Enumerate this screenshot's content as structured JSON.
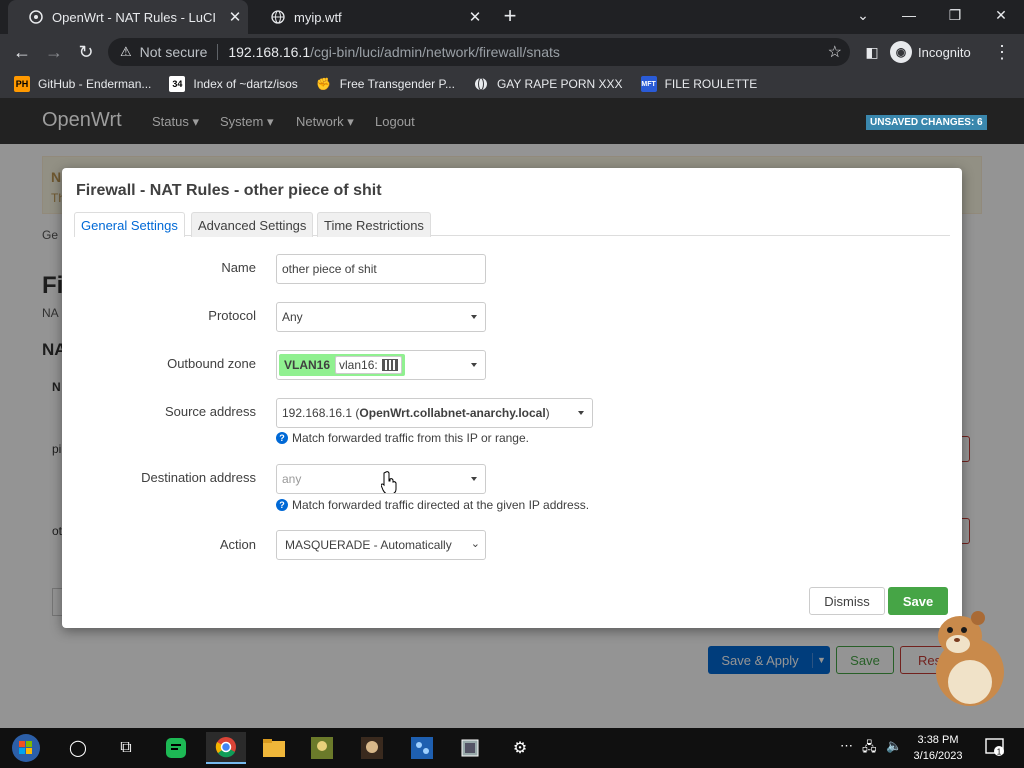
{
  "browser": {
    "tabs": [
      {
        "title": "OpenWrt - NAT Rules - LuCI",
        "active": true
      },
      {
        "title": "myip.wtf",
        "active": false
      }
    ],
    "address": {
      "security": "Not secure",
      "host": "192.168.16.1",
      "path": "/cgi-bin/luci/admin/network/firewall/snats"
    },
    "profile": "Incognito",
    "bookmarks": [
      {
        "icon": "PH",
        "label": "GitHub - Enderman..."
      },
      {
        "icon": "34",
        "label": "Index of ~dartz/isos"
      },
      {
        "icon": "fist",
        "label": "Free Transgender P..."
      },
      {
        "icon": "globe",
        "label": "GAY RAPE PORN XXX"
      },
      {
        "icon": "MFT",
        "label": "FILE ROULETTE"
      }
    ]
  },
  "luci": {
    "brand": "OpenWrt",
    "menu": [
      "Status",
      "System",
      "Network",
      "Logout"
    ],
    "unsaved": "UNSAVED CHANGES: 6",
    "background": {
      "alert_title": "N",
      "alert_text": "Th",
      "tab": "Ge",
      "heading": "Fi",
      "subtitle": "NA",
      "section": "NA",
      "column": "N",
      "row1": "pi",
      "row2": "ot"
    },
    "buttons": {
      "save_apply": "Save & Apply",
      "save": "Save",
      "reset": "Reset"
    }
  },
  "modal": {
    "title": "Firewall - NAT Rules - other piece of shit",
    "tabs": [
      "General Settings",
      "Advanced Settings",
      "Time Restrictions"
    ],
    "name_label": "Name",
    "name_value": "other piece of shit",
    "protocol_label": "Protocol",
    "protocol_value": "Any",
    "outbound_label": "Outbound zone",
    "outbound_zone": "VLAN16",
    "outbound_iface": "vlan16:",
    "source_label": "Source address",
    "source_ip": "192.168.16.1 (",
    "source_host": "OpenWrt.collabnet-anarchy.local",
    "source_close": ")",
    "source_hint": "Match forwarded traffic from this IP or range.",
    "dest_label": "Destination address",
    "dest_placeholder": "any",
    "dest_hint": "Match forwarded traffic directed at the given IP address.",
    "action_label": "Action",
    "action_value": "MASQUERADE - Automatically",
    "dismiss": "Dismiss",
    "save": "Save"
  },
  "taskbar": {
    "time": "3:38 PM",
    "date": "3/16/2023",
    "notifications": "1"
  },
  "colors": {
    "accent": "#0069d6",
    "success": "#46a546",
    "danger": "#c43c35",
    "zone": "#90f090"
  }
}
